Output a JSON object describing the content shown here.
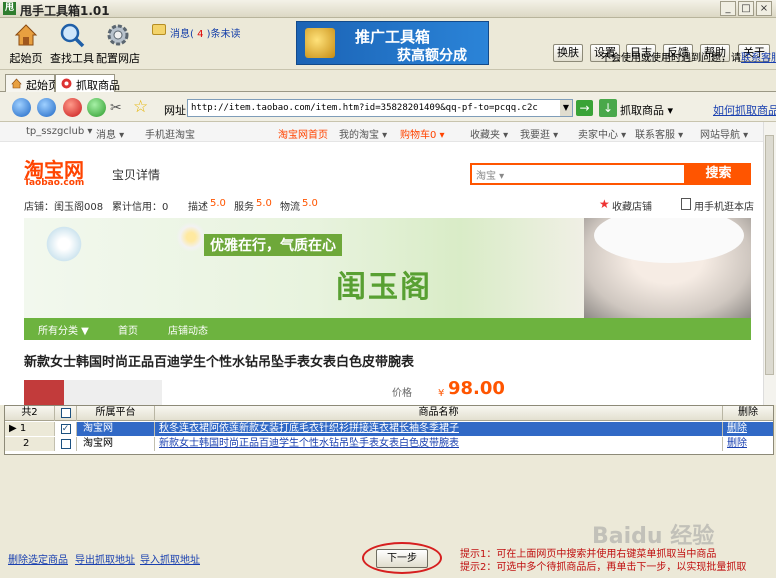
{
  "window": {
    "title": "甩手工具箱1.01",
    "app_icon_label": "甩",
    "minimize": "_",
    "maximize": "□",
    "close": "×"
  },
  "toolbar": {
    "buttons": [
      {
        "label": "起始页",
        "icon": "home-icon"
      },
      {
        "label": "查找工具",
        "icon": "search-icon"
      },
      {
        "label": "配置网店",
        "icon": "gear-icon"
      }
    ],
    "message_prefix": "消息(",
    "message_count": "4",
    "message_suffix": ")条未读",
    "banner": {
      "line1": "推广工具箱",
      "line2": "获高额分成"
    },
    "right_buttons": [
      "换肤",
      "设置",
      "日志",
      "反馈",
      "帮助",
      "关于"
    ],
    "hint": "不会使用或使用时遇到问题，请",
    "hint_link": "联系客服"
  },
  "tabs": [
    {
      "label": "起始页",
      "icon": "home-icon"
    },
    {
      "label": "抓取商品",
      "icon": "taobao-icon"
    }
  ],
  "nav": {
    "url_label": "网址",
    "url": "http://item.taobao.com/item.htm?id=35828201409&qq-pf-to=pcqq.c2c",
    "fetch_label": "抓取商品",
    "fetch_dropdown": "▾",
    "howto_link": "如何抓取商品?"
  },
  "webpage": {
    "top_nav": [
      "tp_sszgclub ▾",
      "消息 ▾",
      "手机逛淘宝",
      "淘宝网首页",
      "我的淘宝 ▾",
      "购物车0 ▾",
      "收藏夹 ▾",
      "我要逛 ▾",
      "卖家中心 ▾",
      "联系客服 ▾",
      "网站导航 ▾"
    ],
    "logo": "淘宝网",
    "logo_sub": "Taobao.com",
    "page_label": "宝贝详情",
    "search_type": "淘宝 ▾",
    "search_button": "搜索",
    "shop_bar": {
      "shop": "店铺：闺玉阁008",
      "credit": "累计信用：0",
      "desc": "描述",
      "desc_score": "5.0",
      "service": "服务",
      "service_score": "5.0",
      "logistics": "物流",
      "logistics_score": "5.0",
      "fav": "收藏店铺",
      "mobile": "用手机逛本店"
    },
    "banner_slogan": "优雅在行，气质在心",
    "banner_brand": "闺玉阁",
    "shop_menu": [
      "所有分类 ▼",
      "首页",
      "店铺动态"
    ],
    "product_title": "新款女士韩国时尚正品百迪学生个性水钻吊坠手表女表白色皮带腕表",
    "price_label": "价格",
    "price_currency": "¥",
    "price_value": "98.00"
  },
  "grid": {
    "count_label": "共2",
    "headers": [
      "所属平台",
      "商品名称",
      "删除"
    ],
    "rows": [
      {
        "index": "1",
        "checked": true,
        "platform": "淘宝网",
        "name": "秋冬连衣裙阿依莲新款女装打底毛衣针织衫拼接连衣裙长袖冬季裙子",
        "delete": "删除"
      },
      {
        "index": "2",
        "checked": false,
        "platform": "淘宝网",
        "name": "新款女士韩国时尚正品百迪学生个性水钻吊坠手表女表白色皮带腕表",
        "delete": "删除"
      }
    ]
  },
  "bottom": {
    "links": [
      "删除选定商品",
      "导出抓取地址",
      "导入抓取地址"
    ],
    "next_button": "下一步",
    "tip1": "提示1：可在上面网页中搜索并使用右键菜单抓取当中商品",
    "tip2": "提示2：可选中多个待抓商品后，再单击下一步，以实现批量抓取",
    "watermark": "Baidu 经验"
  },
  "colors": {
    "taobao_orange": "#ff5500",
    "shop_green": "#6db33f",
    "selected_row": "#3169c6",
    "link_blue": "#1a40b0",
    "tip_red": "#c01010"
  }
}
